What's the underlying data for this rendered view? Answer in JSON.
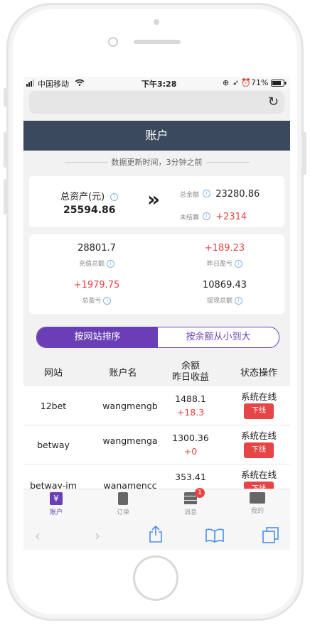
{
  "status": {
    "carrier": "中国移动",
    "time": "下午3:28",
    "battery": "71%"
  },
  "nav": {
    "title": "账户"
  },
  "updated": {
    "text": "数据更新时间，3分钟之前"
  },
  "summary": {
    "total_assets_label": "总资产(元)",
    "total_assets_value": "25594.86",
    "arrow": "»",
    "balance_label": "总余额",
    "balance_value": "23280.86",
    "unsettled_label": "未结算",
    "unsettled_value": "+2314"
  },
  "stats": [
    {
      "value": "28801.7",
      "label": "充值总额",
      "red": false
    },
    {
      "value": "+189.23",
      "label": "昨日盈亏",
      "red": true
    },
    {
      "value": "+1979.75",
      "label": "总盈亏",
      "red": true
    },
    {
      "value": "10869.43",
      "label": "提现总额",
      "red": false
    }
  ],
  "segment": {
    "left": "按网站排序",
    "right": "按余额从小到大"
  },
  "table": {
    "headers": {
      "site": "网站",
      "account": "账户名",
      "balance_line1": "余额",
      "balance_line2": "昨日收益",
      "status": "状态操作"
    },
    "rows": [
      {
        "site": "12bet",
        "account": "wangmengb",
        "balance": "1488.1",
        "profit": "+18.3",
        "status": "系统在线",
        "action": "下线"
      },
      {
        "site": "betway",
        "account": "wangmenga",
        "balance": "1300.36",
        "profit": "+0",
        "status": "系统在线",
        "action": "下线"
      },
      {
        "site": "betway-im",
        "account": "wanamencc",
        "balance": "353.41",
        "profit": "",
        "status": "系统在线",
        "action": "下线"
      }
    ]
  },
  "tabbar": {
    "items": [
      {
        "label": "账户",
        "icon": "wallet-icon",
        "active": true
      },
      {
        "label": "订单",
        "icon": "clipboard-icon",
        "active": false
      },
      {
        "label": "消息",
        "icon": "server-icon",
        "active": false,
        "badge": "1"
      },
      {
        "label": "我的",
        "icon": "id-card-icon",
        "active": false
      }
    ]
  },
  "colors": {
    "nav_bg": "#3a4a5c",
    "accent": "#6a3fb5",
    "red": "#e54545"
  }
}
